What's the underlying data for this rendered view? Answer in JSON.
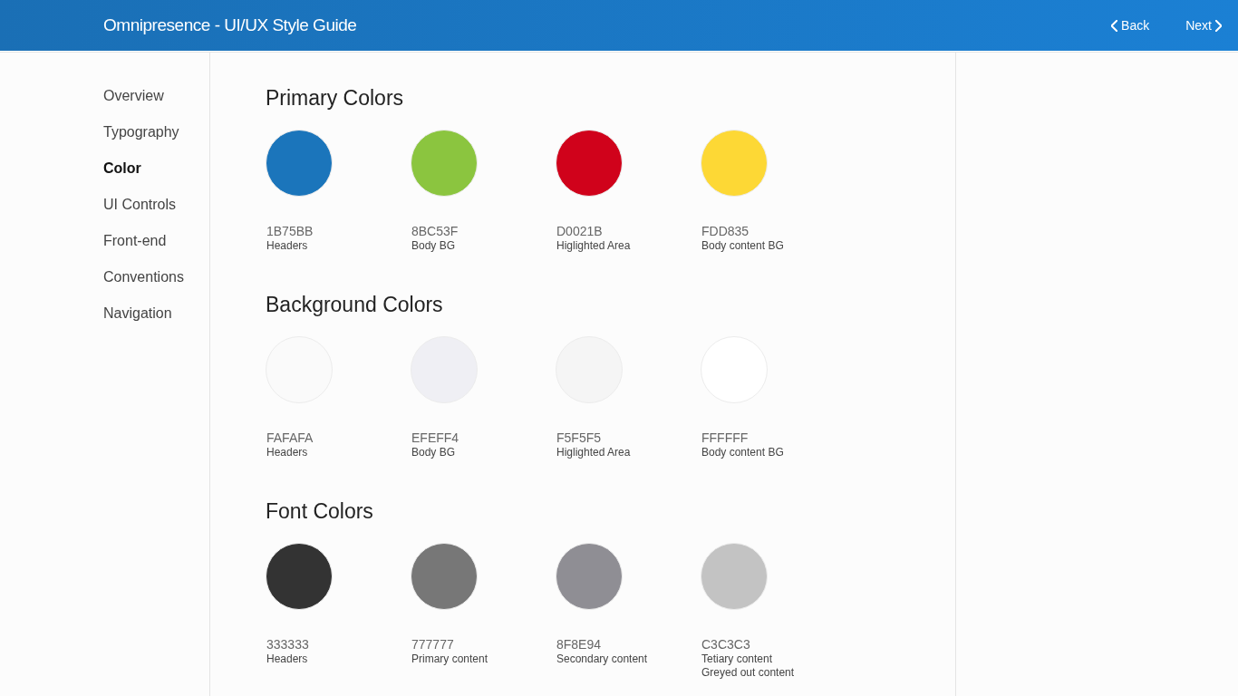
{
  "header": {
    "title": "Omnipresence - UI/UX Style Guide",
    "back": "Back",
    "next": "Next"
  },
  "sidebar": {
    "items": [
      {
        "label": "Overview",
        "selected": false
      },
      {
        "label": "Typography",
        "selected": false
      },
      {
        "label": "Color",
        "selected": true
      },
      {
        "label": "UI Controls",
        "selected": false
      },
      {
        "label": "Front-end",
        "selected": false
      },
      {
        "label": "Conventions",
        "selected": false
      },
      {
        "label": "Navigation",
        "selected": false
      }
    ]
  },
  "sections": [
    {
      "title": "Primary Colors",
      "swatches": [
        {
          "color": "#1b75bb",
          "hex": "1B75BB",
          "labels": [
            "Headers"
          ]
        },
        {
          "color": "#8bc53f",
          "hex": "8BC53F",
          "labels": [
            "Body BG"
          ]
        },
        {
          "color": "#d0021b",
          "hex": "D0021B",
          "labels": [
            "Higlighted Area"
          ]
        },
        {
          "color": "#fdd835",
          "hex": "FDD835",
          "labels": [
            "Body content BG"
          ]
        }
      ]
    },
    {
      "title": "Background Colors",
      "swatches": [
        {
          "color": "#fafafa",
          "hex": "FAFAFA",
          "labels": [
            "Headers"
          ]
        },
        {
          "color": "#efeff4",
          "hex": "EFEFF4",
          "labels": [
            "Body BG"
          ]
        },
        {
          "color": "#f5f5f5",
          "hex": "F5F5F5",
          "labels": [
            "Higlighted Area"
          ]
        },
        {
          "color": "#ffffff",
          "hex": "FFFFFF",
          "labels": [
            "Body content BG"
          ]
        }
      ]
    },
    {
      "title": "Font Colors",
      "swatches": [
        {
          "color": "#333333",
          "hex": "333333",
          "labels": [
            "Headers"
          ]
        },
        {
          "color": "#777777",
          "hex": "777777",
          "labels": [
            "Primary content"
          ]
        },
        {
          "color": "#8f8e94",
          "hex": "8F8E94",
          "labels": [
            "Secondary content"
          ]
        },
        {
          "color": "#c3c3c3",
          "hex": "C3C3C3",
          "labels": [
            "Tetiary content",
            "Greyed out content"
          ]
        }
      ]
    }
  ]
}
